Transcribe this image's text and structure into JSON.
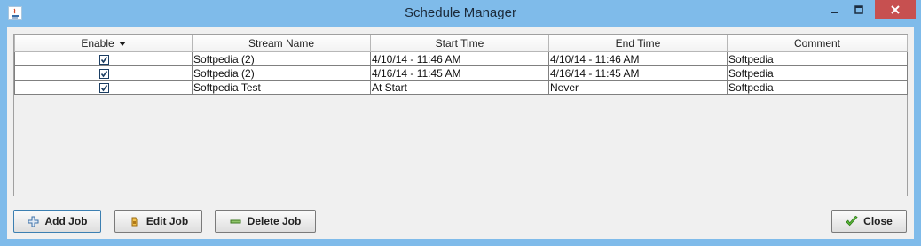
{
  "window": {
    "title": "Schedule Manager"
  },
  "table": {
    "columns": [
      "Enable",
      "Stream Name",
      "Start Time",
      "End Time",
      "Comment"
    ],
    "rows": [
      {
        "enabled": true,
        "stream": "Softpedia (2)",
        "start": "4/10/14 - 11:46 AM",
        "end": "4/10/14 - 11:46 AM",
        "comment": "Softpedia"
      },
      {
        "enabled": true,
        "stream": "Softpedia (2)",
        "start": "4/16/14 - 11:45 AM",
        "end": "4/16/14 - 11:45 AM",
        "comment": "Softpedia"
      },
      {
        "enabled": true,
        "stream": "Softpedia Test",
        "start": "At Start",
        "end": "Never",
        "comment": "Softpedia"
      }
    ]
  },
  "buttons": {
    "add": "Add Job",
    "edit": "Edit Job",
    "delete": "Delete Job",
    "close": "Close"
  }
}
